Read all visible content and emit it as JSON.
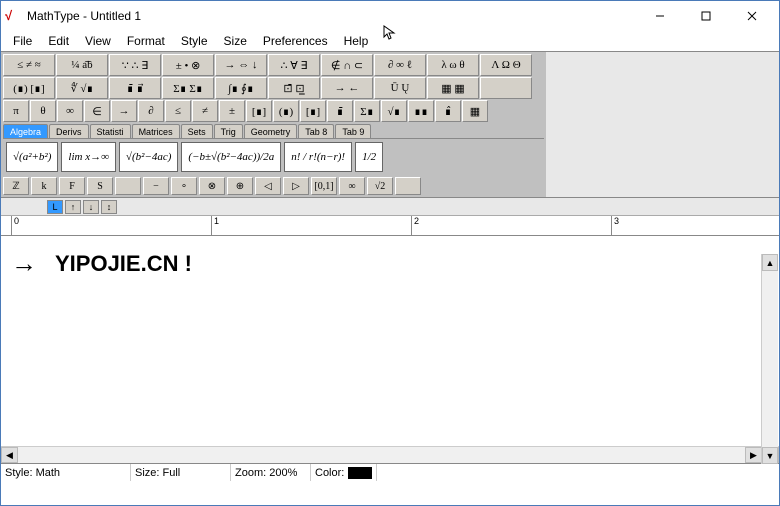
{
  "window": {
    "title": "MathType - Untitled 1"
  },
  "menu": [
    "File",
    "Edit",
    "View",
    "Format",
    "Style",
    "Size",
    "Preferences",
    "Help"
  ],
  "palette_rows": [
    [
      "≤ ≠ ≈",
      "¼ a͡b",
      "∵ ∴ ∃",
      "± • ⊗",
      "→ ⇔ ↓",
      "∴ ∀ ∃",
      "∉ ∩ ⊂",
      "∂ ∞ ℓ",
      "λ ω θ",
      "Λ Ω Θ"
    ],
    [
      "(∎) [∎]",
      "∜ √∎",
      "∎̄ ∎⃗",
      "Σ∎ Σ∎",
      "∫∎ ∮∎",
      "⊡̄ ⊡̲",
      "→ ←",
      "Ū Ų",
      "▦ ▦",
      ""
    ],
    [
      "π",
      "θ",
      "∞",
      "∈",
      "→",
      "∂",
      "≤",
      "≠",
      "±",
      "[∎]",
      "(∎)",
      "[∎]",
      "∎̄",
      "Σ∎",
      "√∎",
      "∎∎",
      "∎̂",
      "▦"
    ]
  ],
  "tabs": [
    "Algebra",
    "Derivs",
    "Statisti",
    "Matrices",
    "Sets",
    "Trig",
    "Geometry",
    "Tab 8",
    "Tab 9"
  ],
  "active_tab": 0,
  "templates": [
    "√(a²+b²)",
    "lim x→∞",
    "√(b²−4ac)",
    "(−b±√(b²−4ac))/2a",
    "n! / r!(n−r)!",
    "1/2"
  ],
  "bottom_bar": [
    "ℤ",
    "k",
    "F",
    "S",
    "",
    "−",
    "∘",
    "⊗",
    "⊕",
    "◁",
    "▷",
    "[0,1]",
    "∞",
    "√2",
    ""
  ],
  "ruler_marks": [
    "0",
    "1",
    "2",
    "3"
  ],
  "editor": {
    "arrow": "→",
    "text": "YIPOJIE.CN !"
  },
  "status": {
    "style_label": "Style:",
    "style_value": "Math",
    "size_label": "Size:",
    "size_value": "Full",
    "zoom_label": "Zoom:",
    "zoom_value": "200%",
    "color_label": "Color:"
  }
}
